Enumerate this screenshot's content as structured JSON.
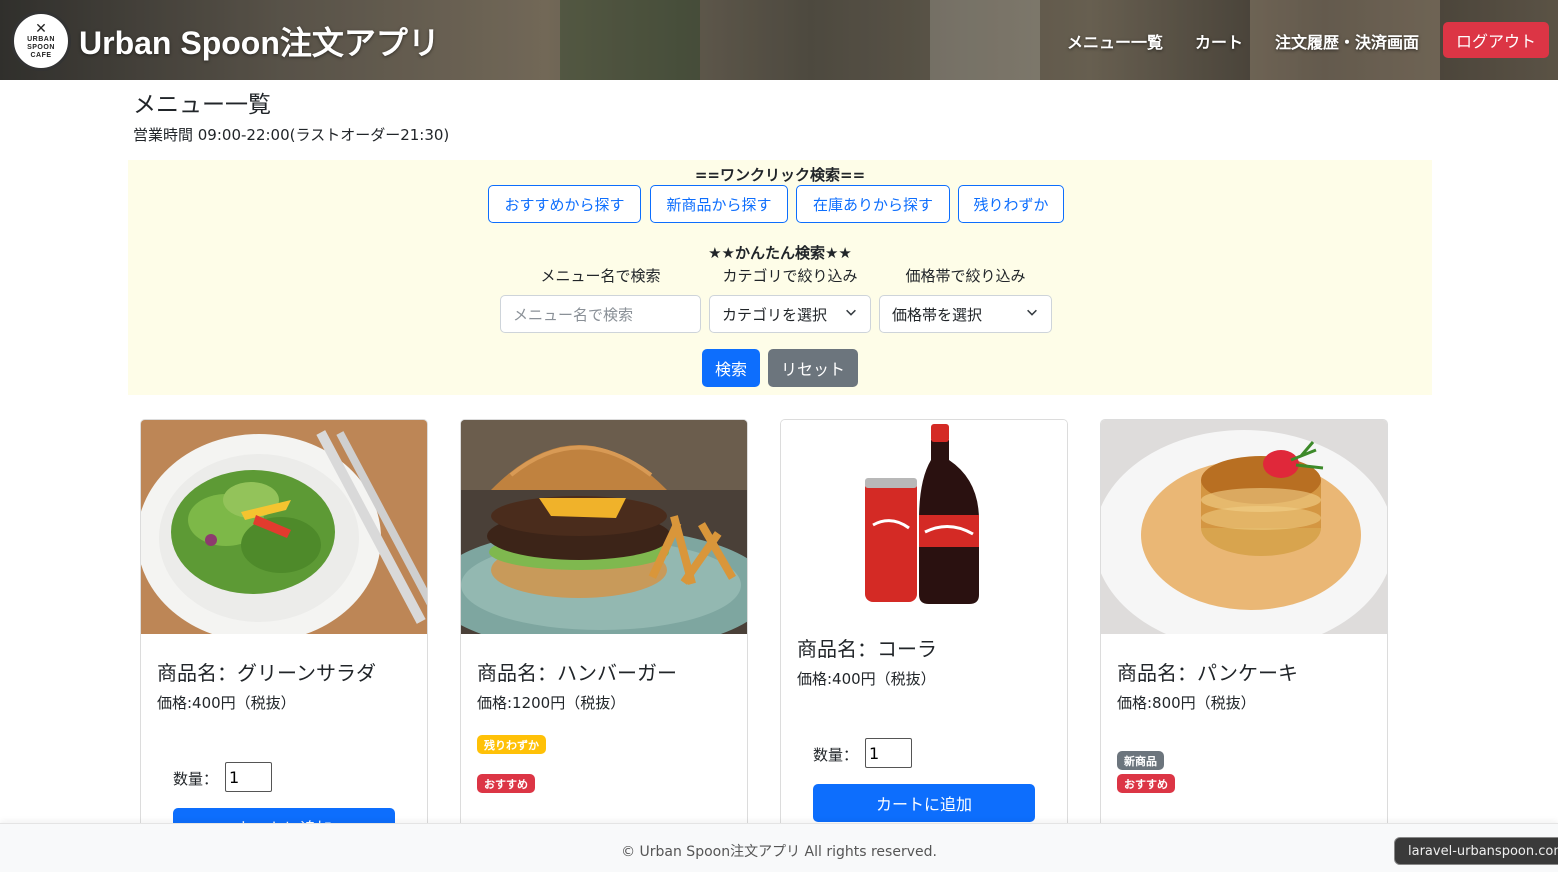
{
  "header": {
    "logo_text": [
      "URBAN",
      "SPOON",
      "CAFE"
    ],
    "title": "Urban Spoon注文アプリ",
    "nav": [
      {
        "label": "メニュー一覧"
      },
      {
        "label": "カート"
      },
      {
        "label": "注文履歴・決済画面"
      }
    ],
    "logout_label": "ログアウト"
  },
  "page": {
    "title": "メニュー一覧",
    "hours": "営業時間 09:00-22:00(ラストオーダー21:30)"
  },
  "quick_search": {
    "heading": "==ワンクリック検索==",
    "buttons": [
      {
        "label": "おすすめから探す"
      },
      {
        "label": "新商品から探す"
      },
      {
        "label": "在庫ありから探す"
      },
      {
        "label": "残りわずか"
      }
    ]
  },
  "easy_search": {
    "heading": "★★かんたん検索★★",
    "name_label": "メニュー名で検索",
    "name_placeholder": "メニュー名で検索",
    "category_label": "カテゴリで絞り込み",
    "category_value": "カテゴリを選択",
    "price_label": "価格帯で絞り込み",
    "price_value": "価格帯を選択",
    "search_button": "検索",
    "reset_button": "リセット"
  },
  "products": [
    {
      "name": "商品名：グリーンサラダ",
      "price": "価格:400円（税抜）",
      "qty_label": "数量：",
      "qty": "1",
      "add_label": "カートに追加",
      "badges": []
    },
    {
      "name": "商品名：ハンバーガー",
      "price": "価格:1200円（税抜）",
      "badges": [
        {
          "label": "残りわずか",
          "color": "#ffc107"
        },
        {
          "label": "おすすめ",
          "color": "#dc3545"
        }
      ]
    },
    {
      "name": "商品名：コーラ",
      "price": "価格:400円（税抜）",
      "qty_label": "数量：",
      "qty": "1",
      "add_label": "カートに追加",
      "badges": []
    },
    {
      "name": "商品名：パンケーキ",
      "price": "価格:800円（税抜）",
      "badges": [
        {
          "label": "新商品",
          "color": "#6c757d"
        },
        {
          "label": "おすすめ",
          "color": "#dc3545"
        }
      ]
    }
  ],
  "footer": {
    "copyright": "© Urban Spoon注文アプリ All rights reserved."
  },
  "status_url": "laravel-urbanspoon.com",
  "colors": {
    "primary": "#0d6efd",
    "danger": "#dc3545",
    "secondary": "#6c757d",
    "warning": "#ffc107",
    "panel_bg": "#fefde8"
  }
}
